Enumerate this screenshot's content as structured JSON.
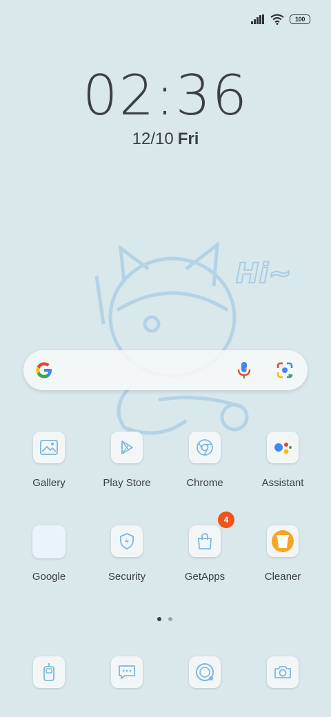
{
  "status": {
    "battery": "100"
  },
  "clock": {
    "time": "02:36",
    "date": "12/10",
    "day": "Fri"
  },
  "wallpaper": {
    "text": "Hi~"
  },
  "apps_row1": [
    {
      "label": "Gallery",
      "icon": "gallery-icon"
    },
    {
      "label": "Play Store",
      "icon": "play-store-icon"
    },
    {
      "label": "Chrome",
      "icon": "chrome-icon"
    },
    {
      "label": "Assistant",
      "icon": "assistant-icon"
    }
  ],
  "apps_row2": [
    {
      "label": "Google",
      "icon": "google-folder-icon"
    },
    {
      "label": "Security",
      "icon": "security-icon"
    },
    {
      "label": "GetApps",
      "icon": "getapps-icon",
      "badge": "4"
    },
    {
      "label": "Cleaner",
      "icon": "cleaner-icon"
    }
  ],
  "dock": [
    {
      "icon": "phone-icon"
    },
    {
      "icon": "messages-icon"
    },
    {
      "icon": "browser-icon"
    },
    {
      "icon": "camera-icon"
    }
  ],
  "colors": {
    "accent_badge": "#f0521b",
    "background": "#d8e8eb"
  }
}
